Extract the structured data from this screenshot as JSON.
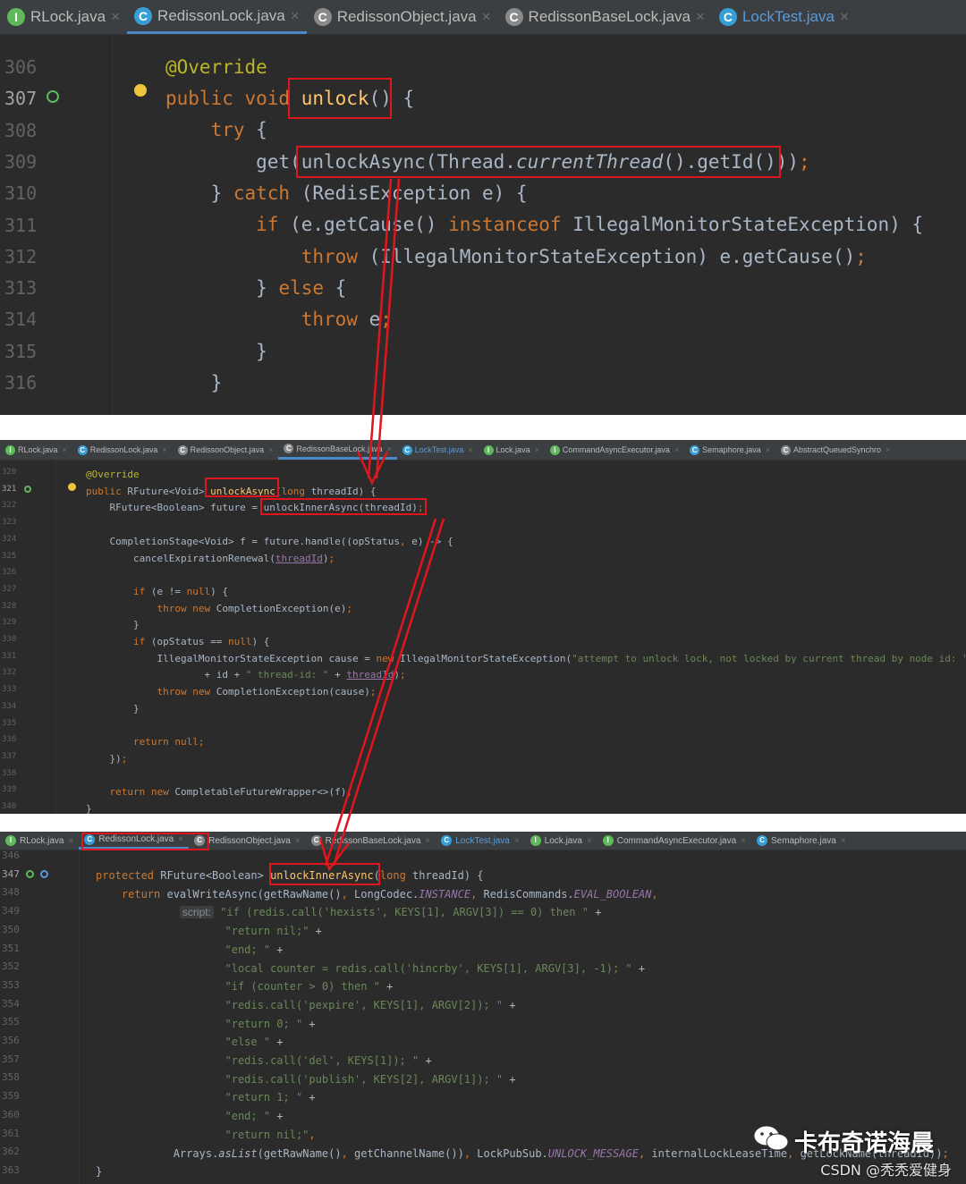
{
  "panel1": {
    "tabs": [
      {
        "label": "RLock.java",
        "icon": "interface-icon",
        "kind": "iface"
      },
      {
        "label": "RedissonLock.java",
        "icon": "class-icon",
        "kind": "class",
        "active": true
      },
      {
        "label": "RedissonObject.java",
        "icon": "abstract-class-icon",
        "kind": "abs"
      },
      {
        "label": "RedissonBaseLock.java",
        "icon": "abstract-class-icon",
        "kind": "abs"
      },
      {
        "label": "LockTest.java",
        "icon": "class-icon",
        "kind": "class",
        "alt": true
      }
    ],
    "lines": [
      "306",
      "307",
      "308",
      "309",
      "310",
      "311",
      "312",
      "313",
      "314",
      "315",
      "316"
    ],
    "current_line": "307"
  },
  "panel2": {
    "tabs": [
      {
        "label": "RLock.java",
        "icon": "interface-icon",
        "kind": "iface"
      },
      {
        "label": "RedissonLock.java",
        "icon": "class-icon",
        "kind": "class"
      },
      {
        "label": "RedissonObject.java",
        "icon": "abstract-class-icon",
        "kind": "abs"
      },
      {
        "label": "RedissonBaseLock.java",
        "icon": "abstract-class-icon",
        "kind": "abs",
        "active": true
      },
      {
        "label": "LockTest.java",
        "icon": "class-icon",
        "kind": "class",
        "alt": true
      },
      {
        "label": "Lock.java",
        "icon": "interface-icon",
        "kind": "iface"
      },
      {
        "label": "CommandAsyncExecutor.java",
        "icon": "interface-icon",
        "kind": "iface"
      },
      {
        "label": "Semaphore.java",
        "icon": "class-icon",
        "kind": "class"
      },
      {
        "label": "AbstractQueuedSynchro",
        "icon": "abstract-class-icon",
        "kind": "abs"
      }
    ],
    "lines": [
      "320",
      "321",
      "322",
      "323",
      "324",
      "325",
      "326",
      "327",
      "328",
      "329",
      "330",
      "331",
      "332",
      "333",
      "334",
      "335",
      "336",
      "337",
      "338",
      "339",
      "340"
    ],
    "current_line": "321"
  },
  "panel3": {
    "tabs": [
      {
        "label": "RLock.java",
        "icon": "interface-icon",
        "kind": "iface"
      },
      {
        "label": "RedissonLock.java",
        "icon": "class-icon",
        "kind": "class",
        "active": true
      },
      {
        "label": "RedissonObject.java",
        "icon": "abstract-class-icon",
        "kind": "abs"
      },
      {
        "label": "RedissonBaseLock.java",
        "icon": "abstract-class-icon",
        "kind": "abs"
      },
      {
        "label": "LockTest.java",
        "icon": "class-icon",
        "kind": "class",
        "alt": true
      },
      {
        "label": "Lock.java",
        "icon": "interface-icon",
        "kind": "iface"
      },
      {
        "label": "CommandAsyncExecutor.java",
        "icon": "interface-icon",
        "kind": "iface"
      },
      {
        "label": "Semaphore.java",
        "icon": "class-icon",
        "kind": "class"
      }
    ],
    "lines": [
      "346",
      "347",
      "348",
      "349",
      "350",
      "351",
      "352",
      "353",
      "354",
      "355",
      "356",
      "357",
      "358",
      "359",
      "360",
      "361",
      "362",
      "363"
    ],
    "current_line": "347",
    "script_hint": "script:"
  },
  "watermark": {
    "title": "卡布奇诺海晨",
    "subtitle": "CSDN @秃秃爱健身"
  },
  "colors": {
    "editor_bg": "#2b2b2b",
    "keyword": "#cc7832",
    "annotation": "#bbb529",
    "method": "#ffc66d",
    "string": "#6a8759",
    "constant": "#9876aa",
    "text": "#a9b7c6",
    "highlight_box": "#e0161e"
  }
}
